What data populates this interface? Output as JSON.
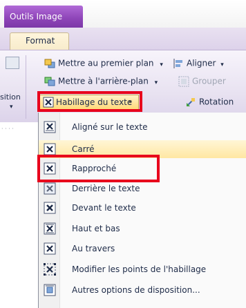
{
  "titlebar": {
    "context_tab": "Outils Image"
  },
  "tabs": {
    "active": "Format"
  },
  "ribbon": {
    "left_group_label": "sition",
    "bring_forward": "Mettre au premier plan",
    "send_backward": "Mettre à l'arrière-plan",
    "align": "Aligner",
    "group": "Grouper",
    "rotation": "Rotation",
    "text_wrapping": "Habillage du texte"
  },
  "menu": {
    "items": [
      {
        "label": "Aligné sur le texte",
        "icon": "inline-wrap-icon"
      },
      {
        "label": "Carré",
        "icon": "square-wrap-icon"
      },
      {
        "label": "Rapproché",
        "icon": "tight-wrap-icon"
      },
      {
        "label": "Derrière le texte",
        "icon": "behind-text-icon"
      },
      {
        "label": "Devant le texte",
        "icon": "in-front-text-icon"
      },
      {
        "label": "Haut et bas",
        "icon": "top-bottom-icon"
      },
      {
        "label": "Au travers",
        "icon": "through-wrap-icon"
      },
      {
        "label": "Modifier les points de l'habillage",
        "icon": "edit-wrap-points-icon"
      },
      {
        "label": "Autres options de disposition...",
        "icon": "layout-options-icon"
      }
    ]
  },
  "colors": {
    "context_tab": "#9a52c4",
    "highlight_box": "#e8001c",
    "hover": "#ffe7a2"
  }
}
